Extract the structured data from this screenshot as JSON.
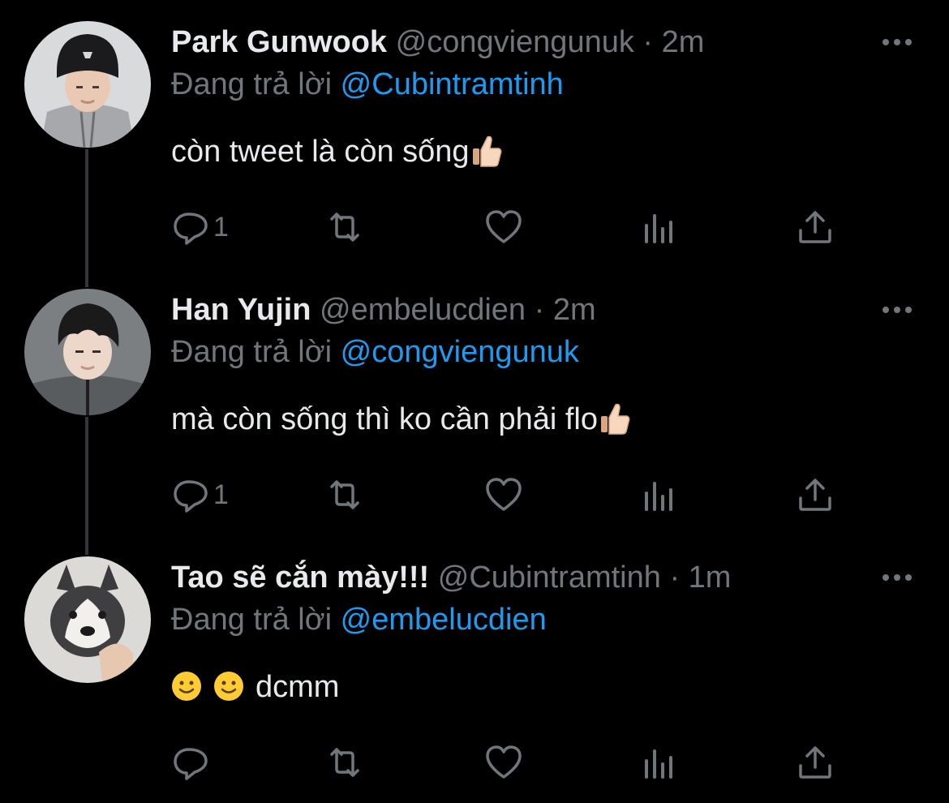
{
  "tweets": [
    {
      "display_name": "Park Gunwook",
      "handle": "@congviengunuk",
      "time": "2m",
      "replying_prefix": "Đang trả lời",
      "replying_to": "@Cubintramtinh",
      "text": "còn tweet là còn sống",
      "trailing_emoji": "thumbs-up-icon",
      "reply_count": "1",
      "avatar": "person-beanie-avatar"
    },
    {
      "display_name": "Han Yujin",
      "handle": "@embelucdien",
      "time": "2m",
      "replying_prefix": "Đang trả lời",
      "replying_to": "@congviengunuk",
      "text": "mà còn sống thì ko cần phải flo",
      "trailing_emoji": "thumbs-up-icon",
      "reply_count": "1",
      "avatar": "person-avatar"
    },
    {
      "display_name": "Tao sẽ cắn mày!!!",
      "handle": "@Cubintramtinh",
      "time": "1m",
      "replying_prefix": "Đang trả lời",
      "replying_to": "@embelucdien",
      "text": "dcmm",
      "leading_emojis": [
        "slightly-smiling-face-icon",
        "slightly-smiling-face-icon"
      ],
      "reply_count": "",
      "avatar": "husky-dog-avatar"
    }
  ],
  "separator": "·",
  "colors": {
    "background": "#000000",
    "primary_text": "#e7e9ea",
    "secondary_text": "#71767b",
    "accent": "#1d9bf0",
    "thread_line": "#333639"
  }
}
